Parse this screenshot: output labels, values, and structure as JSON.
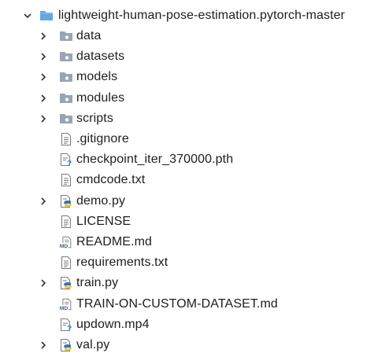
{
  "root": {
    "label": "lightweight-human-pose-estimation.pytorch-master",
    "icon": "folder-open-icon",
    "expanded": true
  },
  "items": [
    {
      "label": "data",
      "icon": "folder-icon",
      "expandable": true
    },
    {
      "label": "datasets",
      "icon": "folder-icon",
      "expandable": true
    },
    {
      "label": "models",
      "icon": "folder-icon",
      "expandable": true
    },
    {
      "label": "modules",
      "icon": "folder-icon",
      "expandable": true
    },
    {
      "label": "scripts",
      "icon": "folder-icon",
      "expandable": true
    },
    {
      "label": ".gitignore",
      "icon": "text-file-icon",
      "expandable": false
    },
    {
      "label": "checkpoint_iter_370000.pth",
      "icon": "unknown-file-icon",
      "expandable": false
    },
    {
      "label": "cmdcode.txt",
      "icon": "text-file-icon",
      "expandable": false
    },
    {
      "label": "demo.py",
      "icon": "python-file-icon",
      "expandable": true
    },
    {
      "label": "LICENSE",
      "icon": "text-file-icon",
      "expandable": false
    },
    {
      "label": "README.md",
      "icon": "markdown-file-icon",
      "expandable": false
    },
    {
      "label": "requirements.txt",
      "icon": "text-file-icon",
      "expandable": false
    },
    {
      "label": "train.py",
      "icon": "python-file-icon",
      "expandable": true
    },
    {
      "label": "TRAIN-ON-CUSTOM-DATASET.md",
      "icon": "markdown-file-icon",
      "expandable": false
    },
    {
      "label": "updown.mp4",
      "icon": "unknown-file-icon",
      "expandable": false
    },
    {
      "label": "val.py",
      "icon": "python-file-icon",
      "expandable": true
    }
  ],
  "colors": {
    "chevron": "#333333",
    "folder_open": "#64a8e0",
    "folder": "#9aa4b2",
    "file_outline": "#7a7a7a",
    "python_blue": "#3b73b4",
    "python_yellow": "#f3c83a",
    "unknown_mark": "#2f7fd0"
  }
}
